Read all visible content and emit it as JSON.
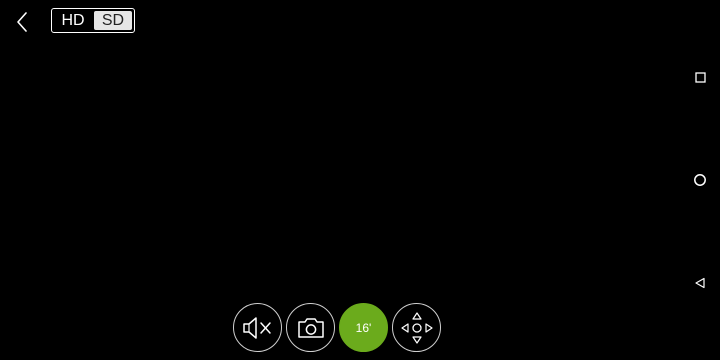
{
  "topbar": {
    "back_icon": "chevron-left-icon",
    "quality": {
      "options": [
        "HD",
        "SD"
      ],
      "selected": "SD"
    }
  },
  "nav": {
    "recent_icon": "square-icon",
    "home_icon": "circle-icon",
    "back_icon": "triangle-left-icon"
  },
  "controls": {
    "mute_icon": "speaker-muted-icon",
    "snapshot_icon": "camera-icon",
    "timer_label": "16'",
    "ptz_icon": "direction-pad-icon"
  },
  "colors": {
    "background": "#000000",
    "accent": "#6bab1c",
    "toggle_active_bg": "#e6e6e6"
  }
}
